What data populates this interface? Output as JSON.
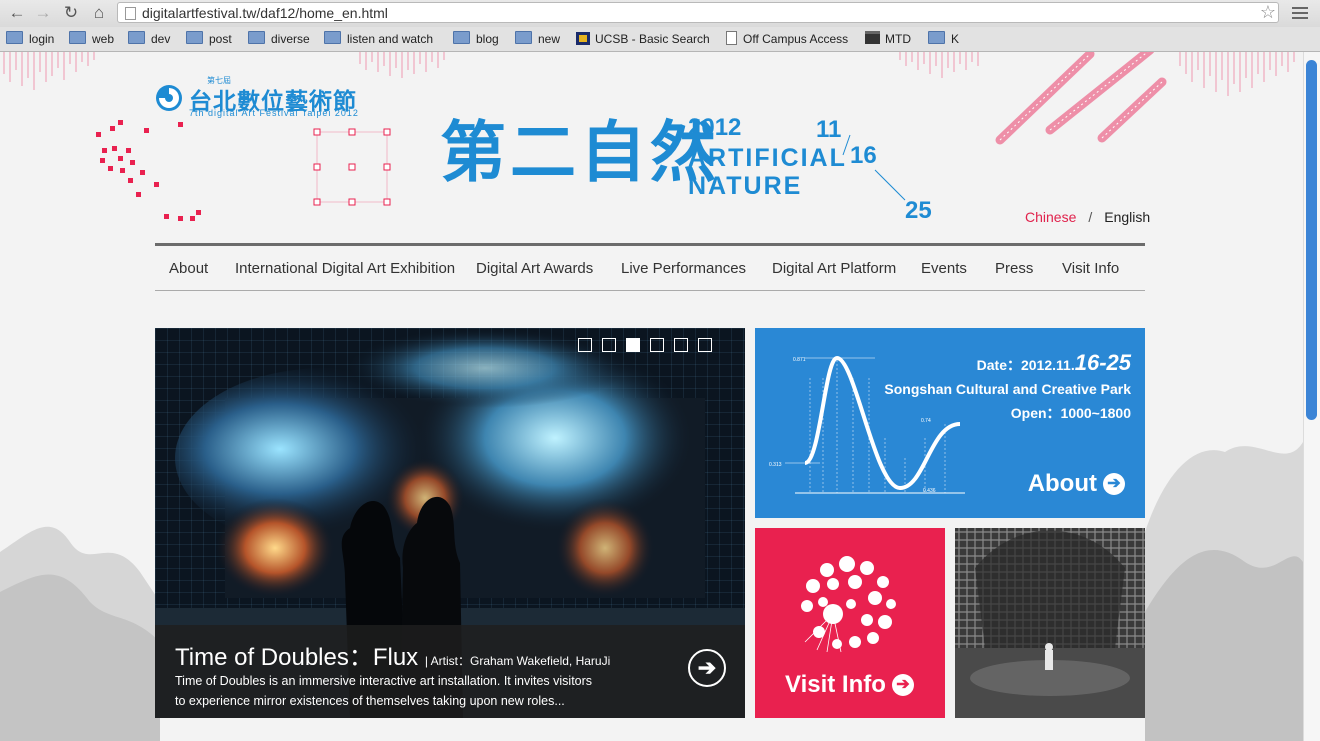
{
  "browser": {
    "url": "digitalartfestival.tw/daf12/home_en.html",
    "back": "←",
    "forward": "→",
    "reload": "↻",
    "home": "⌂",
    "star": "☆",
    "bookmarks": [
      {
        "label": "login",
        "icon": "folder-icon"
      },
      {
        "label": "web",
        "icon": "folder-icon"
      },
      {
        "label": "dev",
        "icon": "folder-icon"
      },
      {
        "label": "post",
        "icon": "folder-icon"
      },
      {
        "label": "diverse",
        "icon": "folder-icon"
      },
      {
        "label": "listen and watch",
        "icon": "folder-icon"
      },
      {
        "label": "blog",
        "icon": "folder-icon"
      },
      {
        "label": "new",
        "icon": "folder-icon"
      },
      {
        "label": "UCSB - Basic Search",
        "icon": "ucsb-icon"
      },
      {
        "label": "Off Campus Access",
        "icon": "page-icon"
      },
      {
        "label": "MTD",
        "icon": "bus-icon"
      },
      {
        "label": "K",
        "icon": "folder-icon"
      }
    ]
  },
  "header": {
    "logo_cn": "台北數位藝術節",
    "logo_small": "第七屆",
    "logo_en": "7th digital Art Festival Taipei 2012",
    "title_cn": "第二自然",
    "year": "2012",
    "title_en_1": "ARTIFICIAL",
    "title_en_2": "NATURE",
    "date_month": "11",
    "date_start": "16",
    "date_end": "25",
    "lang_cn": "Chinese",
    "lang_sep": "/",
    "lang_en": "English"
  },
  "nav": [
    "About",
    "International Digital Art Exhibition",
    "Digital Art Awards",
    "Live Performances",
    "Digital Art Platform",
    "Events",
    "Press",
    "Visit Info"
  ],
  "hero": {
    "slides": 6,
    "active_slide": 3,
    "title": "Time of Doubles：Flux",
    "artist": "| Artist：Graham Wakefield, HaruJi",
    "desc_line1": "Time of Doubles is an immersive interactive art installation. It invites visitors",
    "desc_line2": "to experience mirror existences of themselves taking upon new roles..."
  },
  "info": {
    "date_prefix": "Date：2012.11.",
    "date_range": "16-25",
    "venue": "Songshan Cultural and Creative Park",
    "open": "Open：1000~1800",
    "about_label": "About",
    "arrow": "➔",
    "chart_labels": [
      "0.871",
      "0.313",
      "0.74",
      "0.436"
    ]
  },
  "visit": {
    "label": "Visit Info",
    "arrow": "➔"
  },
  "colors": {
    "accent_blue": "#1e8bd3",
    "accent_pink": "#e9214f",
    "info_blue": "#2a88d5"
  }
}
